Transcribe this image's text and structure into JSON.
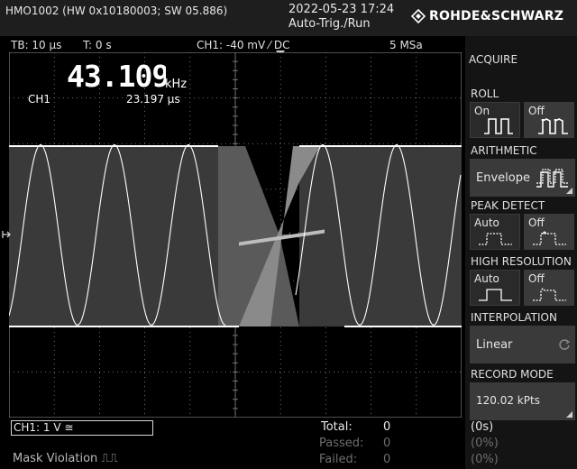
{
  "header": {
    "model": "HMO1002 (HW 0x10180003; SW 05.886)",
    "datetime": "2022-05-23 17:24",
    "trigger_state": "Auto-Trig./Run",
    "brand": "ROHDE&SCHWARZ"
  },
  "statusline": {
    "timebase": "TB: 10 µs",
    "trigger_time": "T: 0 s",
    "channel": "CH1: -40 mV ⁄ DC",
    "sample_rate": "5 MSa"
  },
  "readout": {
    "frequency": "43.109",
    "frequency_unit": "kHz",
    "channel": "CH1",
    "period": "23.197 µs"
  },
  "menu": {
    "title": "ACQUIRE",
    "roll": {
      "title": "ROLL",
      "on": "On",
      "off": "Off"
    },
    "arithmetic": {
      "title": "ARITHMETIC",
      "value": "Envelope"
    },
    "peak_detect": {
      "title": "PEAK DETECT",
      "auto": "Auto",
      "off": "Off"
    },
    "high_resolution": {
      "title": "HIGH RESOLUTION",
      "auto": "Auto",
      "off": "Off"
    },
    "interpolation": {
      "title": "INTERPOLATION",
      "value": "Linear"
    },
    "record_mode": {
      "title": "RECORD MODE",
      "value": "120.02 kPts"
    }
  },
  "footer": {
    "ch1_scale": "CH1: 1 V ≅",
    "mask": "Mask Violation ⎍⎍",
    "total_label": "Total:",
    "total_value": "0",
    "total_pct": "(0s)",
    "passed_label": "Passed:",
    "passed_value": "0",
    "passed_pct": "(0%)",
    "failed_label": "Failed:",
    "failed_value": "0",
    "failed_pct": "(0%)"
  },
  "colors": {
    "grid": "#8a8a8a",
    "trace": "#ffffff",
    "envelope": "#bdbdbd",
    "panel": "#2a2a2a"
  }
}
